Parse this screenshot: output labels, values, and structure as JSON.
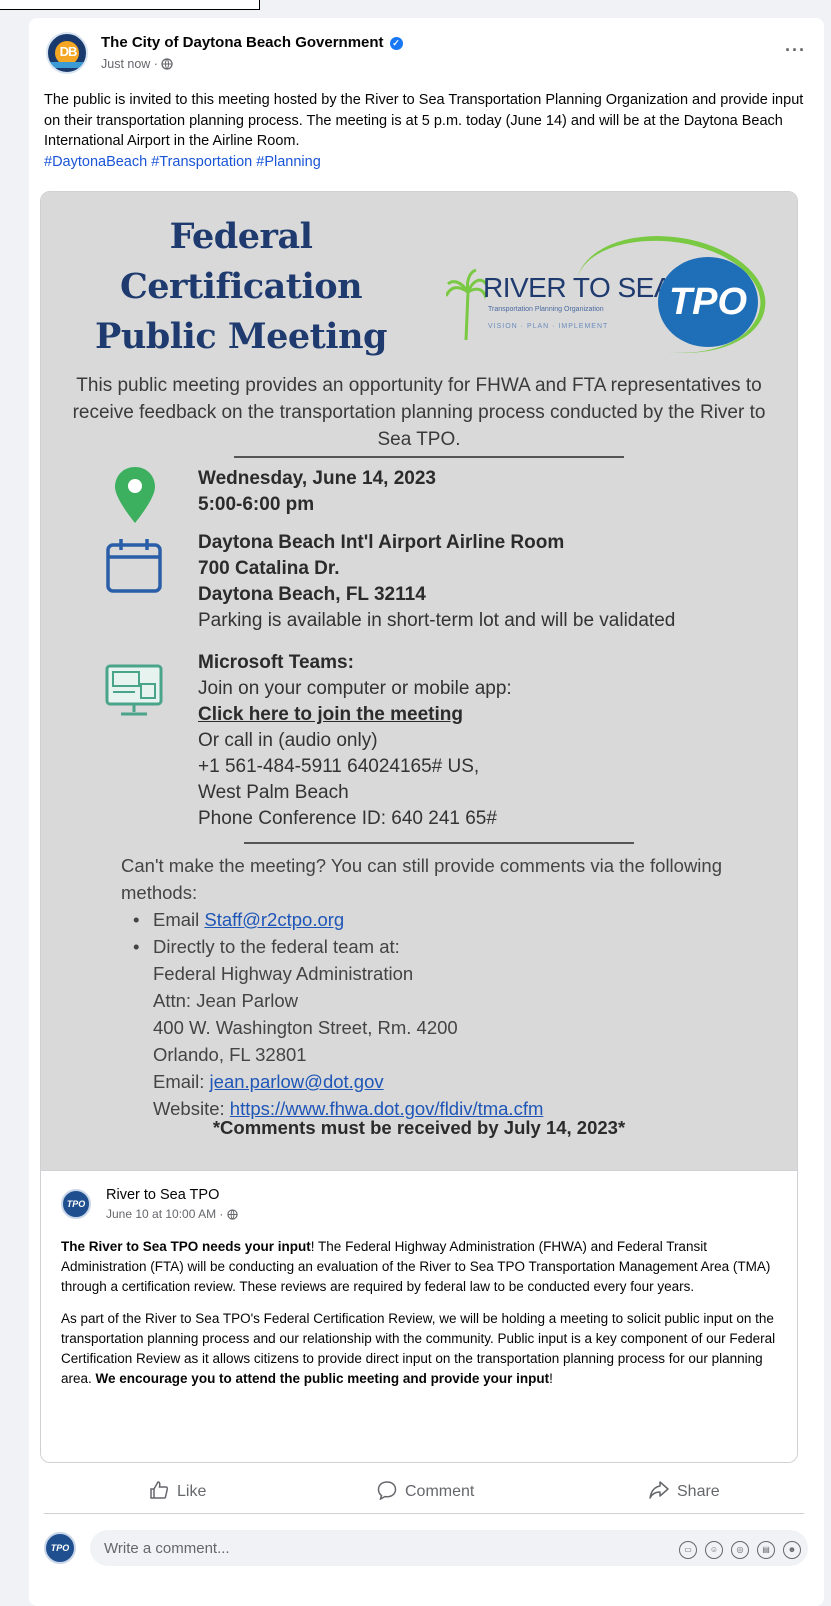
{
  "post": {
    "page_name": "The City of Daytona Beach Government",
    "time": "Just now · ",
    "text": "The public is invited to this meeting hosted by the River to Sea Transportation Planning Organization and provide input on their transportation planning process. The meeting is at 5 p.m. today (June 14) and will be at the Daytona Beach International Airport in the Airline Room.",
    "hashtags": [
      "#DaytonaBeach",
      "#Transportation",
      "#Planning"
    ],
    "more": "···"
  },
  "flyer": {
    "title_lines": [
      "Federal",
      "Certification",
      "Public Meeting"
    ],
    "logo": {
      "name": "RIVER TO SEA",
      "subtitle": "Transportation Planning Organization",
      "tagline": "VISION · PLAN · IMPLEMENT",
      "badge": "TPO"
    },
    "intro": "This public meeting provides an opportunity for FHWA and FTA representatives to receive feedback on the transportation planning process conducted by the River to Sea TPO.",
    "date": "Wednesday, June 14, 2023",
    "time": "5:00-6:00 pm",
    "location": "Daytona Beach Int'l Airport Airline Room",
    "street": "700 Catalina Dr.",
    "city": "Daytona Beach, FL 32114",
    "parking": "Parking is available in short-term lot and will be validated",
    "teams_title": "Microsoft Teams:",
    "teams_join": "Join on your computer or mobile app:",
    "teams_link": "Click here to join the meeting",
    "call_in": "Or call in (audio only)",
    "phone": "+1 561-484-5911  64024165#  US,",
    "phone_city": "West Palm Beach",
    "conference_id": "Phone Conference ID: 640 241 65#",
    "comments_intro": "Can't make the meeting? You can still provide comments via the following methods:",
    "email_label": "Email ",
    "email": "Staff@r2ctpo.org",
    "direct": "Directly to the federal team at:",
    "fhwa": "Federal Highway Administration",
    "attn": "Attn: Jean Parlow",
    "address": "400 W. Washington Street, Rm. 4200",
    "address_city": "Orlando, FL 32801",
    "email2_label": "Email: ",
    "email2": "jean.parlow@dot.gov",
    "website_label": "Website: ",
    "website": "https://www.fhwa.dot.gov/fldiv/tma.cfm",
    "deadline": "*Comments must be received by July 14, 2023*"
  },
  "shared": {
    "name": "River to Sea TPO",
    "time": "June 10 at 10:00 AM · ",
    "avatar": "TPO",
    "p1_bold": "The River to Sea TPO needs your input",
    "p1_rest": "! The Federal Highway Administration (FHWA) and Federal Transit Administration (FTA) will be conducting an evaluation of the River to Sea TPO Transportation Management Area (TMA) through a certification review. These reviews are required by federal law to be conducted every four years.",
    "p2": "As part of the River to Sea TPO's Federal Certification Review, we will be holding a meeting to solicit public input on the transportation planning process and our relationship with the community. Public input is a key component of our Federal Certification Review as it allows citizens to provide direct input on the transportation planning process for our planning area. ",
    "p2_bold": "We encourage you to attend the public meeting and provide your input",
    "p2_end": "!"
  },
  "actions": {
    "like": "Like",
    "comment": "Comment",
    "share": "Share"
  },
  "comment_box": {
    "placeholder": "Write a comment...",
    "avatar": "TPO"
  },
  "colors": {
    "accent": "#1877f2",
    "flyer_bg": "#d9d9d9",
    "title": "#1e3a6e",
    "pin": "#3cb05e",
    "link": "#1e56b8"
  }
}
